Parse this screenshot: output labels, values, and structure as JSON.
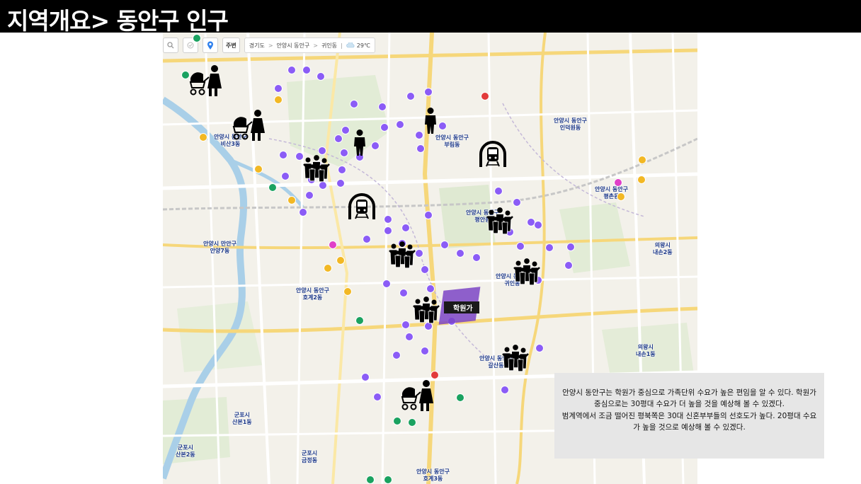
{
  "header": {
    "title": "지역개요> 동안구 인구"
  },
  "toolbar": {
    "nearby_label": "주변",
    "breadcrumbs": [
      "경기도",
      "안양시 동안구",
      "귀인동"
    ],
    "weather": "29℃"
  },
  "map": {
    "district_labels": [
      "안양시 동안구\n인덕원동",
      "안양시 동안구\n부림동",
      "안양시 동안구\n비산3동",
      "안양시 동안구\n평촌동",
      "안양시 동안구\n평안동",
      "안양시 동안구\n귀인동",
      "안양시 동안구\n호계2동",
      "안양시 동안구\n갈산동",
      "안양시 만안구\n안양7동",
      "군포시\n산본1동",
      "군포시\n산본2동",
      "군포시\n금정동",
      "안양시 동안구\n호계3동",
      "의왕시\n내손2동",
      "의왕시\n내손1동"
    ],
    "academy_label": "학원가"
  },
  "note": {
    "lines": [
      "안양시 동안구는 학원가 중심으로 가족단위 수요가 높은 편임을 알 수 있다. 학원가 중심으로는 30평대 수요가 더 높을 것을 예상해 볼 수 있겠다.",
      "범계역에서 조금 떨어진 평북쪽은 30대 신혼부부들의 선호도가 높다. 20평대 수요가 높을 것으로 예상해 볼 수 있겠다."
    ]
  },
  "icons": {
    "stroller": "stroller-woman-icon",
    "single": "person-icon",
    "family": "family-group-icon",
    "subway": "subway-station-icon"
  },
  "colors": {
    "poi_purple": "#8b5cf6",
    "poi_yellow": "#f2b824",
    "poi_green": "#1aa260",
    "poi_red": "#e23b3b",
    "poi_pink": "#e040c8",
    "academy_fill": "#7b45c6"
  }
}
